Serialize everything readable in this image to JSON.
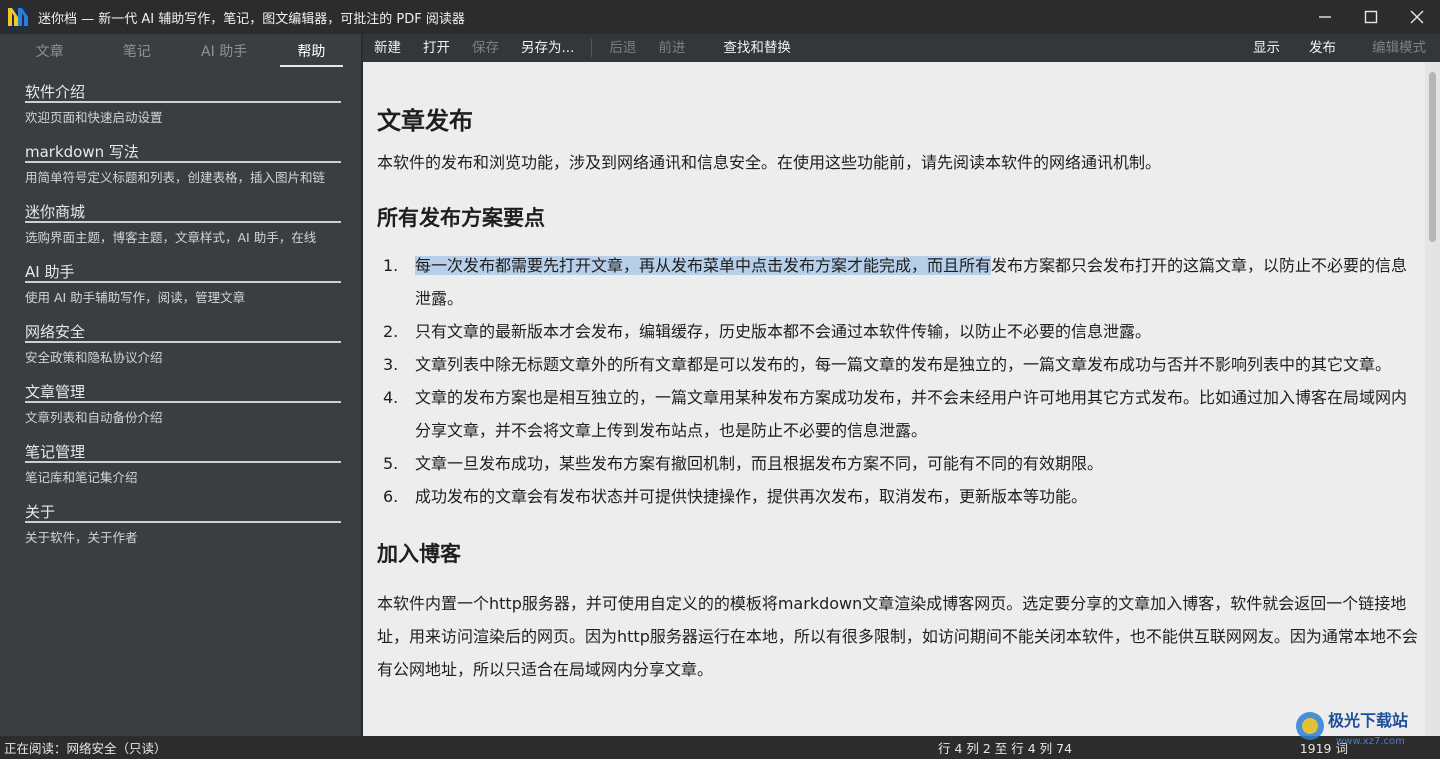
{
  "window": {
    "title": "迷你档 — 新一代 AI 辅助写作，笔记，图文编辑器，可批注的 PDF 阅读器",
    "logo_text": "M"
  },
  "sidebar": {
    "tabs": [
      {
        "label": "文章",
        "active": false
      },
      {
        "label": "笔记",
        "active": false
      },
      {
        "label": "AI 助手",
        "active": false
      },
      {
        "label": "帮助",
        "active": true
      }
    ],
    "items": [
      {
        "title": "软件介绍",
        "desc": "欢迎页面和快速启动设置"
      },
      {
        "title": "markdown 写法",
        "desc": "用简单符号定义标题和列表，创建表格，插入图片和链"
      },
      {
        "title": "迷你商城",
        "desc": "选购界面主题，博客主题，文章样式，AI 助手，在线"
      },
      {
        "title": "AI 助手",
        "desc": "使用 AI 助手辅助写作，阅读，管理文章"
      },
      {
        "title": "网络安全",
        "desc": "安全政策和隐私协议介绍"
      },
      {
        "title": "文章管理",
        "desc": "文章列表和自动备份介绍"
      },
      {
        "title": "笔记管理",
        "desc": "笔记库和笔记集介绍"
      },
      {
        "title": "关于",
        "desc": "关于软件，关于作者"
      }
    ]
  },
  "toolbar": {
    "new": "新建",
    "open": "打开",
    "save": "保存",
    "save_as": "另存为...",
    "back": "后退",
    "forward": "前进",
    "find_replace": "查找和替换",
    "display": "显示",
    "publish": "发布",
    "edit_mode": "编辑模式"
  },
  "document": {
    "h1": "文章发布",
    "intro": "本软件的发布和浏览功能，涉及到网络通讯和信息安全。在使用这些功能前，请先阅读本软件的网络通讯机制。",
    "h2_points": "所有发布方案要点",
    "list": [
      {
        "num": "1.",
        "highlight": "每一次发布都需要先打开文章，再从发布菜单中点击发布方案才能完成，而且所有",
        "text": "发布方案都只会发布打开的这篇文章，以防止不必要的信息泄露。"
      },
      {
        "num": "2.",
        "highlight": "",
        "text": "只有文章的最新版本才会发布，编辑缓存，历史版本都不会通过本软件传输，以防止不必要的信息泄露。"
      },
      {
        "num": "3.",
        "highlight": "",
        "text": "文章列表中除无标题文章外的所有文章都是可以发布的，每一篇文章的发布是独立的，一篇文章发布成功与否并不影响列表中的其它文章。"
      },
      {
        "num": "4.",
        "highlight": "",
        "text": "文章的发布方案也是相互独立的，一篇文章用某种发布方案成功发布，并不会未经用户许可地用其它方式发布。比如通过加入博客在局域网内分享文章，并不会将文章上传到发布站点，也是防止不必要的信息泄露。"
      },
      {
        "num": "5.",
        "highlight": "",
        "text": "文章一旦发布成功，某些发布方案有撤回机制，而且根据发布方案不同，可能有不同的有效期限。"
      },
      {
        "num": "6.",
        "highlight": "",
        "text": "成功发布的文章会有发布状态并可提供快捷操作，提供再次发布，取消发布，更新版本等功能。"
      }
    ],
    "h2_blog": "加入博客",
    "blog_para": "本软件内置一个http服务器，并可使用自定义的的模板将markdown文章渲染成博客网页。选定要分享的文章加入博客，软件就会返回一个链接地址，用来访问渲染后的网页。因为http服务器运行在本地，所以有很多限制，如访问期间不能关闭本软件，也不能供互联网网友。因为通常本地不会有公网地址，所以只适合在局域网内分享文章。"
  },
  "status": {
    "reading": "正在阅读：网络安全（只读）",
    "position": "行 4 列 2 至 行 4 列 74",
    "words": "1919 词"
  },
  "watermark": {
    "text": "极光下载站",
    "url": "www.xz7.com"
  },
  "colors": {
    "sidebar_bg": "#3b3e41",
    "toolbar_bg": "#33363a",
    "content_bg": "#ededed",
    "highlight": "#b7cfe8",
    "logo_yellow": "#f3c623",
    "logo_blue": "#2a7fd4"
  },
  "icons": {
    "minimize": "minimize-icon",
    "maximize": "maximize-icon",
    "close": "close-icon"
  }
}
